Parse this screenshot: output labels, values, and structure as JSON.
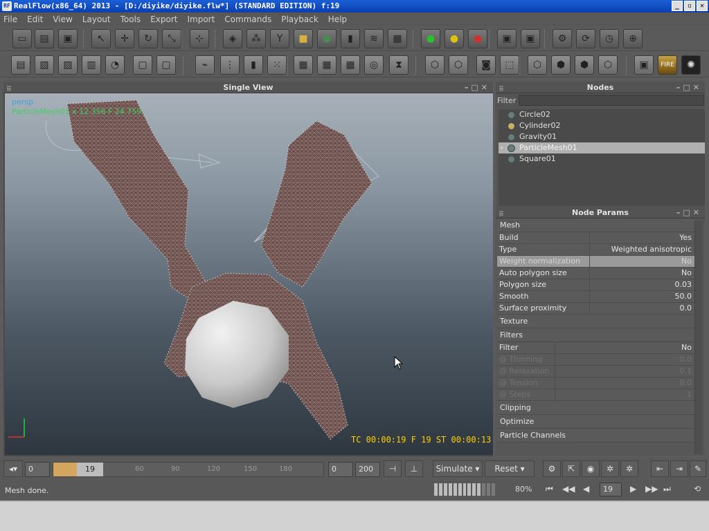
{
  "title": "RealFlow(x86_64) 2013 - [D:/diyike/diyike.flw*] (STANDARD EDITION) f:19",
  "app_icon": "RF",
  "window_buttons": [
    "_",
    "▫",
    "✕"
  ],
  "menu": [
    "File",
    "Edit",
    "View",
    "Layout",
    "Tools",
    "Export",
    "Import",
    "Commands",
    "Playback",
    "Help"
  ],
  "toolbar1": [
    {
      "icon": "new-scene-icon",
      "glyph": "▭"
    },
    {
      "icon": "open-folder-icon",
      "glyph": "▤"
    },
    {
      "icon": "save-icon",
      "glyph": "▣"
    },
    {
      "icon": "select-arrow-icon",
      "glyph": "↖"
    },
    {
      "icon": "move-icon",
      "glyph": "✛"
    },
    {
      "icon": "rotate-icon",
      "glyph": "↻"
    },
    {
      "icon": "scale-icon",
      "glyph": "⤡"
    },
    {
      "icon": "axis-icon",
      "glyph": "⊹"
    },
    {
      "icon": "object-icon",
      "glyph": "◈"
    },
    {
      "icon": "emitter-icon",
      "glyph": "⁂"
    },
    {
      "icon": "daemon-icon",
      "glyph": "Y"
    },
    {
      "icon": "cube-icon",
      "glyph": "■"
    },
    {
      "icon": "mesh-icon",
      "glyph": "●"
    },
    {
      "icon": "camera-icon",
      "glyph": "▮"
    },
    {
      "icon": "wave-icon",
      "glyph": "≋"
    },
    {
      "icon": "rigid-icon",
      "glyph": "▦"
    },
    {
      "icon": "green-circle-icon",
      "glyph": "●"
    },
    {
      "icon": "yellow-circle-icon",
      "glyph": "●"
    },
    {
      "icon": "red-circle-icon",
      "glyph": "●"
    },
    {
      "icon": "save-green-icon",
      "glyph": "▣"
    },
    {
      "icon": "save-red-icon",
      "glyph": "▣"
    },
    {
      "icon": "batch-run-icon",
      "glyph": "⚙"
    },
    {
      "icon": "script-run-icon",
      "glyph": "⟳"
    },
    {
      "icon": "timer-run-icon",
      "glyph": "◷"
    },
    {
      "icon": "network-run-icon",
      "glyph": "⊕"
    }
  ],
  "toolbar2": [
    {
      "icon": "layout1-icon",
      "glyph": "▤"
    },
    {
      "icon": "layout2-icon",
      "glyph": "▧"
    },
    {
      "icon": "layout3-icon",
      "glyph": "▨"
    },
    {
      "icon": "layout4-icon",
      "glyph": "▥"
    },
    {
      "icon": "layout5-icon",
      "glyph": "◔"
    },
    {
      "icon": "box-icon",
      "glyph": "▢"
    },
    {
      "icon": "box2-icon",
      "glyph": "▢"
    },
    {
      "icon": "graph-icon",
      "glyph": "⌁"
    },
    {
      "icon": "grid-icon",
      "glyph": "⋮"
    },
    {
      "icon": "ruler-icon",
      "glyph": "▮"
    },
    {
      "icon": "dots-icon",
      "glyph": "⁙"
    },
    {
      "icon": "frame1-icon",
      "glyph": "▦"
    },
    {
      "icon": "frame2-icon",
      "glyph": "▦"
    },
    {
      "icon": "frame3-icon",
      "glyph": "▦"
    },
    {
      "icon": "frame4-icon",
      "glyph": "◎"
    },
    {
      "icon": "hourglass-icon",
      "glyph": "⧗"
    },
    {
      "icon": "shade1-icon",
      "glyph": "⬡"
    },
    {
      "icon": "shade2-icon",
      "glyph": "⬡"
    },
    {
      "icon": "shade3-icon",
      "glyph": "◙"
    },
    {
      "icon": "shade4-icon",
      "glyph": "⬚"
    },
    {
      "icon": "cube-wire-icon",
      "glyph": "⬡"
    },
    {
      "icon": "cube-solid-icon",
      "glyph": "⬢"
    },
    {
      "icon": "cube-shade-icon",
      "glyph": "⬢"
    },
    {
      "icon": "cube-white-icon",
      "glyph": "⬡"
    },
    {
      "icon": "render-icon",
      "glyph": "▣"
    },
    {
      "icon": "fire-icon",
      "glyph": "FIRE"
    },
    {
      "icon": "hybrido-icon",
      "glyph": "✺"
    }
  ],
  "viewport": {
    "panel_title": "Single View",
    "camera_label": "persp",
    "info_text": "ParticleMesh01  x 12.356  F 24.759",
    "timecode": "TC 00:00:19    F 19    ST 00:00:13"
  },
  "nodes": {
    "panel_title": "Nodes",
    "filter_label": "Filter",
    "items": [
      {
        "name": "Circle02",
        "selected": false,
        "expandable": false
      },
      {
        "name": "Cylinder02",
        "selected": false,
        "expandable": false
      },
      {
        "name": "Gravity01",
        "selected": false,
        "expandable": false
      },
      {
        "name": "ParticleMesh01",
        "selected": true,
        "expandable": true
      },
      {
        "name": "Square01",
        "selected": false,
        "expandable": false
      }
    ]
  },
  "params": {
    "panel_title": "Node Params",
    "mesh_section": "Mesh",
    "rows": [
      {
        "key": "Build",
        "value": "Yes"
      },
      {
        "key": "Type",
        "value": "Weighted anisotropic"
      },
      {
        "key": "Weight normalization",
        "value": "No",
        "highlight": true
      },
      {
        "key": "Auto polygon size",
        "value": "No"
      },
      {
        "key": "Polygon size",
        "value": "0.03"
      },
      {
        "key": "Smooth",
        "value": "50.0"
      },
      {
        "key": "Surface proximity",
        "value": "0.0"
      }
    ],
    "texture_section": "Texture",
    "filters_section": "Filters",
    "filter_row": {
      "key": "Filter",
      "value": "No"
    },
    "filter_dim_rows": [
      {
        "key": "@ Thinning",
        "value": "0.0"
      },
      {
        "key": "@ Relaxation",
        "value": "0.1"
      },
      {
        "key": "@ Tension",
        "value": "0.0"
      },
      {
        "key": "@ Steps",
        "value": "1"
      }
    ],
    "clipping_section": "Clipping",
    "optimize_section": "Optimize",
    "channels_section": "Particle Channels"
  },
  "timeline": {
    "start_field": "0",
    "current_frame": "19",
    "ticks": [
      "60",
      "90",
      "120",
      "150",
      "180"
    ],
    "range_start": "0",
    "range_end": "200",
    "simulate_label": "Simulate",
    "reset_label": "Reset"
  },
  "status": {
    "message": "Mesh done.",
    "progress_percent": "80%",
    "progress_fraction": 0.8,
    "frame_value": "19"
  },
  "playback": [
    "⏮",
    "◀◀",
    "◀",
    "▶",
    "▶▶",
    "⏭",
    "⟲"
  ]
}
